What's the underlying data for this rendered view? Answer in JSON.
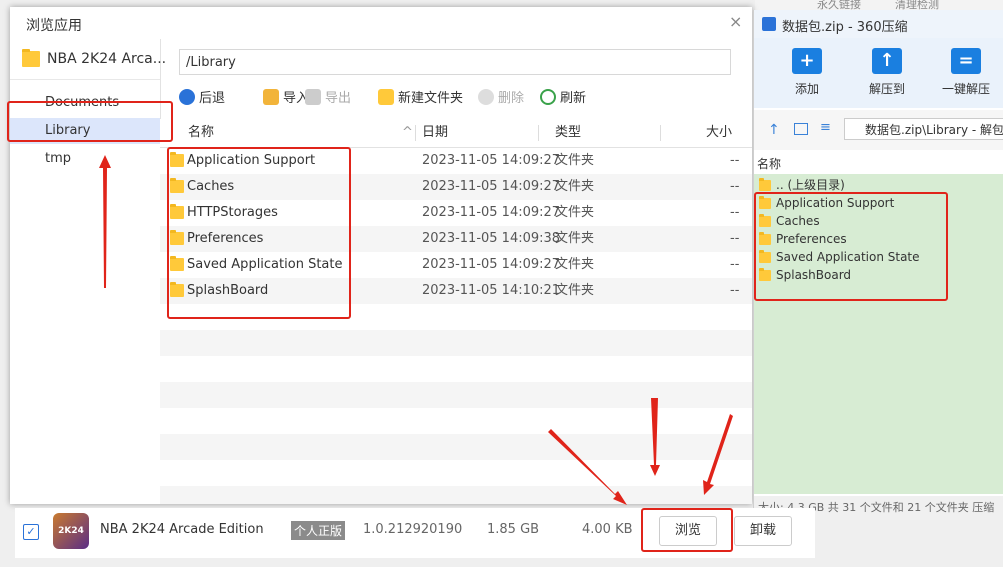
{
  "background_window": {
    "tab_a": "永久链接",
    "tab_b": "清理检测"
  },
  "dialog": {
    "title": "浏览应用",
    "close": "×",
    "app_name": "NBA 2K24 Arca...",
    "left_items": [
      "Documents",
      "Library",
      "tmp"
    ],
    "path": "/Library",
    "toolbar": {
      "back": "后退",
      "import": "导入",
      "export": "导出",
      "new_folder": "新建文件夹",
      "delete": "删除",
      "refresh": "刷新"
    },
    "columns": {
      "name": "名称",
      "date": "日期",
      "type": "类型",
      "size": "大小"
    },
    "files": [
      {
        "name": "Application Support",
        "date": "2023-11-05 14:09:27",
        "type": "文件夹",
        "size": "--"
      },
      {
        "name": "Caches",
        "date": "2023-11-05 14:09:27",
        "type": "文件夹",
        "size": "--"
      },
      {
        "name": "HTTPStorages",
        "date": "2023-11-05 14:09:27",
        "type": "文件夹",
        "size": "--"
      },
      {
        "name": "Preferences",
        "date": "2023-11-05 14:09:38",
        "type": "文件夹",
        "size": "--"
      },
      {
        "name": "Saved Application State",
        "date": "2023-11-05 14:09:27",
        "type": "文件夹",
        "size": "--"
      },
      {
        "name": "SplashBoard",
        "date": "2023-11-05 14:10:21",
        "type": "文件夹",
        "size": "--"
      }
    ]
  },
  "zip_window": {
    "title": "数据包.zip - 360压缩",
    "toolbar": {
      "add": "添加",
      "extract_to": "解压到",
      "one_click": "一键解压"
    },
    "path": "数据包.zip\\Library - 解包",
    "column_name": "名称",
    "parent": ".. (上级目录)",
    "items": [
      "Application Support",
      "Caches",
      "Preferences",
      "Saved Application State",
      "SplashBoard"
    ],
    "status": "大小: 4.3 GB 共 31 个文件和 21 个文件夹 压缩"
  },
  "app_row": {
    "icon_text": "2K24",
    "name": "NBA 2K24 Arcade Edition",
    "badge": "个人正版",
    "version": "1.0.212920190",
    "size": "1.85 GB",
    "doc_size": "4.00 KB",
    "browse_button": "浏览",
    "uninstall_button": "卸载"
  },
  "colors": {
    "annotation": "#e0241a",
    "selection": "#dce6fb",
    "zip_list_bg": "#d7ecd3"
  }
}
